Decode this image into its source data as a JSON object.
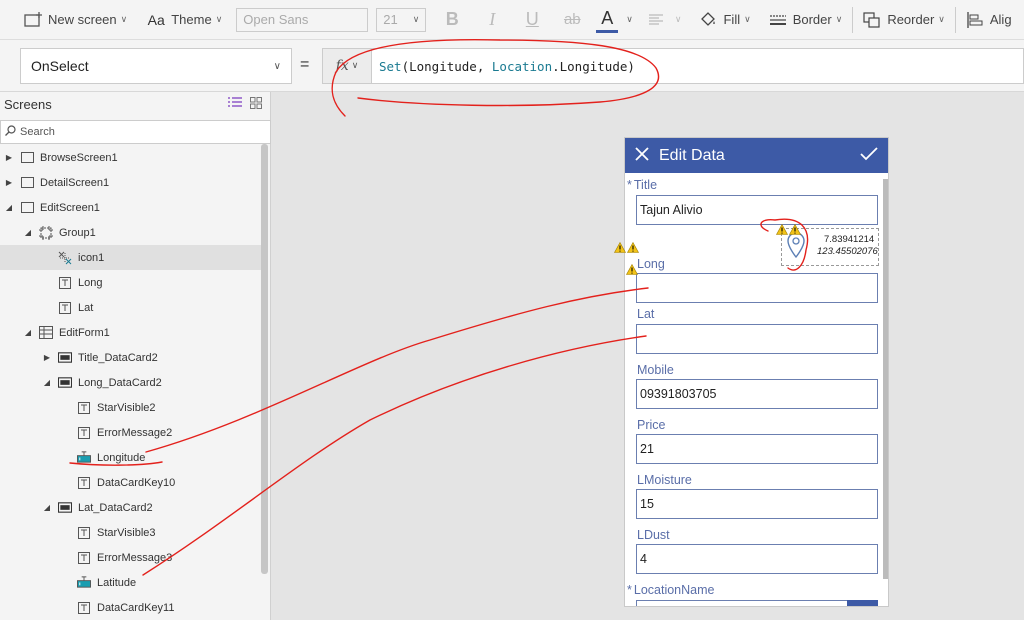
{
  "toolbar": {
    "new_screen": "New screen",
    "theme": "Theme",
    "font": "Open Sans",
    "font_size": "21",
    "bold": "B",
    "italic": "I",
    "underline": "U",
    "strike": "ab",
    "font_color": "A",
    "fill": "Fill",
    "border": "Border",
    "reorder": "Reorder",
    "align": "Alig"
  },
  "formula_bar": {
    "property": "OnSelect",
    "equals": "=",
    "fx": "fx",
    "formula_fn": "Set",
    "formula_arg1": "(Longitude, ",
    "formula_kw": "Location",
    "formula_arg2": ".Longitude)"
  },
  "left_panel": {
    "title": "Screens",
    "search_placeholder": "Search",
    "tree": [
      {
        "label": "BrowseScreen1",
        "indent": 0,
        "twisty": "▶",
        "icon": "screen-icon"
      },
      {
        "label": "DetailScreen1",
        "indent": 0,
        "twisty": "▶",
        "icon": "screen-icon"
      },
      {
        "label": "EditScreen1",
        "indent": 0,
        "twisty": "◢",
        "icon": "screen-icon"
      },
      {
        "label": "Group1",
        "indent": 1,
        "twisty": "◢",
        "icon": "group-icon"
      },
      {
        "label": "icon1",
        "indent": 2,
        "twisty": "",
        "icon": "icon-control-icon",
        "selected": true
      },
      {
        "label": "Long",
        "indent": 2,
        "twisty": "",
        "icon": "label-icon"
      },
      {
        "label": "Lat",
        "indent": 2,
        "twisty": "",
        "icon": "label-icon"
      },
      {
        "label": "EditForm1",
        "indent": 1,
        "twisty": "◢",
        "icon": "form-icon"
      },
      {
        "label": "Title_DataCard2",
        "indent": 2,
        "twisty": "▶",
        "icon": "card-icon"
      },
      {
        "label": "Long_DataCard2",
        "indent": 2,
        "twisty": "◢",
        "icon": "card-icon"
      },
      {
        "label": "StarVisible2",
        "indent": 3,
        "twisty": "",
        "icon": "label-icon"
      },
      {
        "label": "ErrorMessage2",
        "indent": 3,
        "twisty": "",
        "icon": "label-icon"
      },
      {
        "label": "Longitude",
        "indent": 3,
        "twisty": "",
        "icon": "textinput-icon"
      },
      {
        "label": "DataCardKey10",
        "indent": 3,
        "twisty": "",
        "icon": "label-icon"
      },
      {
        "label": "Lat_DataCard2",
        "indent": 2,
        "twisty": "◢",
        "icon": "card-icon"
      },
      {
        "label": "StarVisible3",
        "indent": 3,
        "twisty": "",
        "icon": "label-icon"
      },
      {
        "label": "ErrorMessage3",
        "indent": 3,
        "twisty": "",
        "icon": "label-icon"
      },
      {
        "label": "Latitude",
        "indent": 3,
        "twisty": "",
        "icon": "textinput-icon"
      },
      {
        "label": "DataCardKey11",
        "indent": 3,
        "twisty": "",
        "icon": "label-icon"
      }
    ]
  },
  "app": {
    "header_title": "Edit Data",
    "fields": [
      {
        "label": "Title",
        "required": true,
        "value": ""
      },
      {
        "label": "Long",
        "required": false,
        "value": ""
      },
      {
        "label": "Lat",
        "required": false,
        "value": ""
      },
      {
        "label": "Mobile",
        "required": false,
        "value": "09391803705"
      },
      {
        "label": "Price",
        "required": false,
        "value": "21"
      },
      {
        "label": "LMoisture",
        "required": false,
        "value": "15"
      },
      {
        "label": "LDust",
        "required": false,
        "value": "4"
      },
      {
        "label": "LocationName",
        "required": true,
        "value": ""
      }
    ],
    "title_value": "Tajun Alivio",
    "coord_long": "7.83941214",
    "coord_lat": "123.45502076"
  },
  "colors": {
    "accent": "#3d5aa6",
    "annotation": "#e3211c",
    "formula_keyword": "#1a7a91"
  }
}
